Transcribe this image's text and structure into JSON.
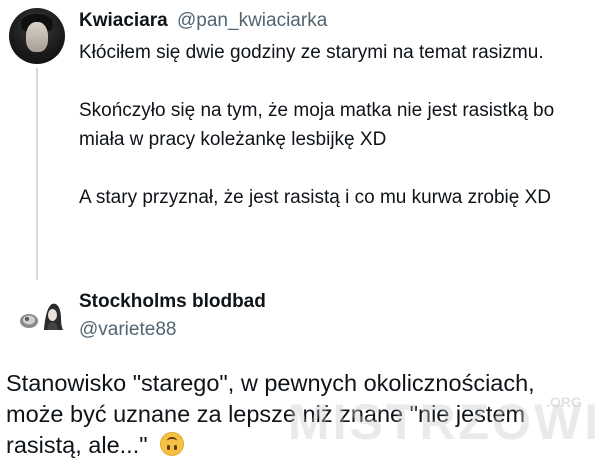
{
  "tweet1": {
    "name": "Kwiaciara",
    "handle": "@pan_kwiaciarka",
    "paragraphs": [
      "Kłóciłem się dwie godziny ze starymi na temat rasizmu.",
      "Skończyło się na tym, że moja matka nie jest rasistką bo miała w pracy koleżankę lesbijkę XD",
      "A stary przyznał, że jest rasistą i co mu kurwa zrobię XD"
    ]
  },
  "tweet2": {
    "name": "Stockholms blodbad",
    "handle": "@variete88",
    "body": "Stanowisko \"starego\", w pewnych okolicznościach, może być uznane za lepsze niż znane \"nie jestem rasistą, ale...\"",
    "emoji": "upside-down-face-emoji"
  },
  "watermark": {
    "text": "MISTRZOWIE",
    "suffix": ".ORG"
  }
}
